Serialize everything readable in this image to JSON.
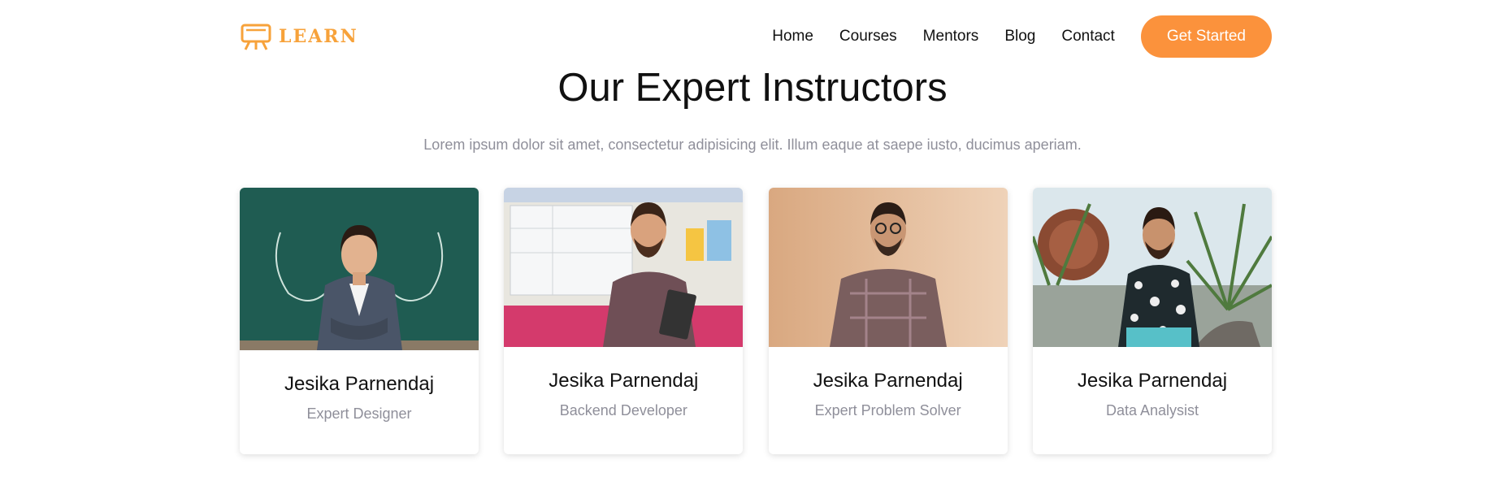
{
  "brand": {
    "logo_text": "LEARN",
    "accent_color": "#f7a23a"
  },
  "nav": {
    "links": [
      "Home",
      "Courses",
      "Mentors",
      "Blog",
      "Contact"
    ],
    "cta_label": "Get Started",
    "cta_color": "#fb923c"
  },
  "section": {
    "title": "Our Expert Instructors",
    "subtitle": "Lorem ipsum dolor sit amet, consectetur adipisicing elit. Illum eaque at saepe iusto, ducimus aperiam."
  },
  "instructors": [
    {
      "name": "Jesika Parnendaj",
      "role": "Expert Designer"
    },
    {
      "name": "Jesika Parnendaj",
      "role": "Backend Developer"
    },
    {
      "name": "Jesika Parnendaj",
      "role": "Expert Problem Solver"
    },
    {
      "name": "Jesika Parnendaj",
      "role": "Data Analysist"
    }
  ]
}
